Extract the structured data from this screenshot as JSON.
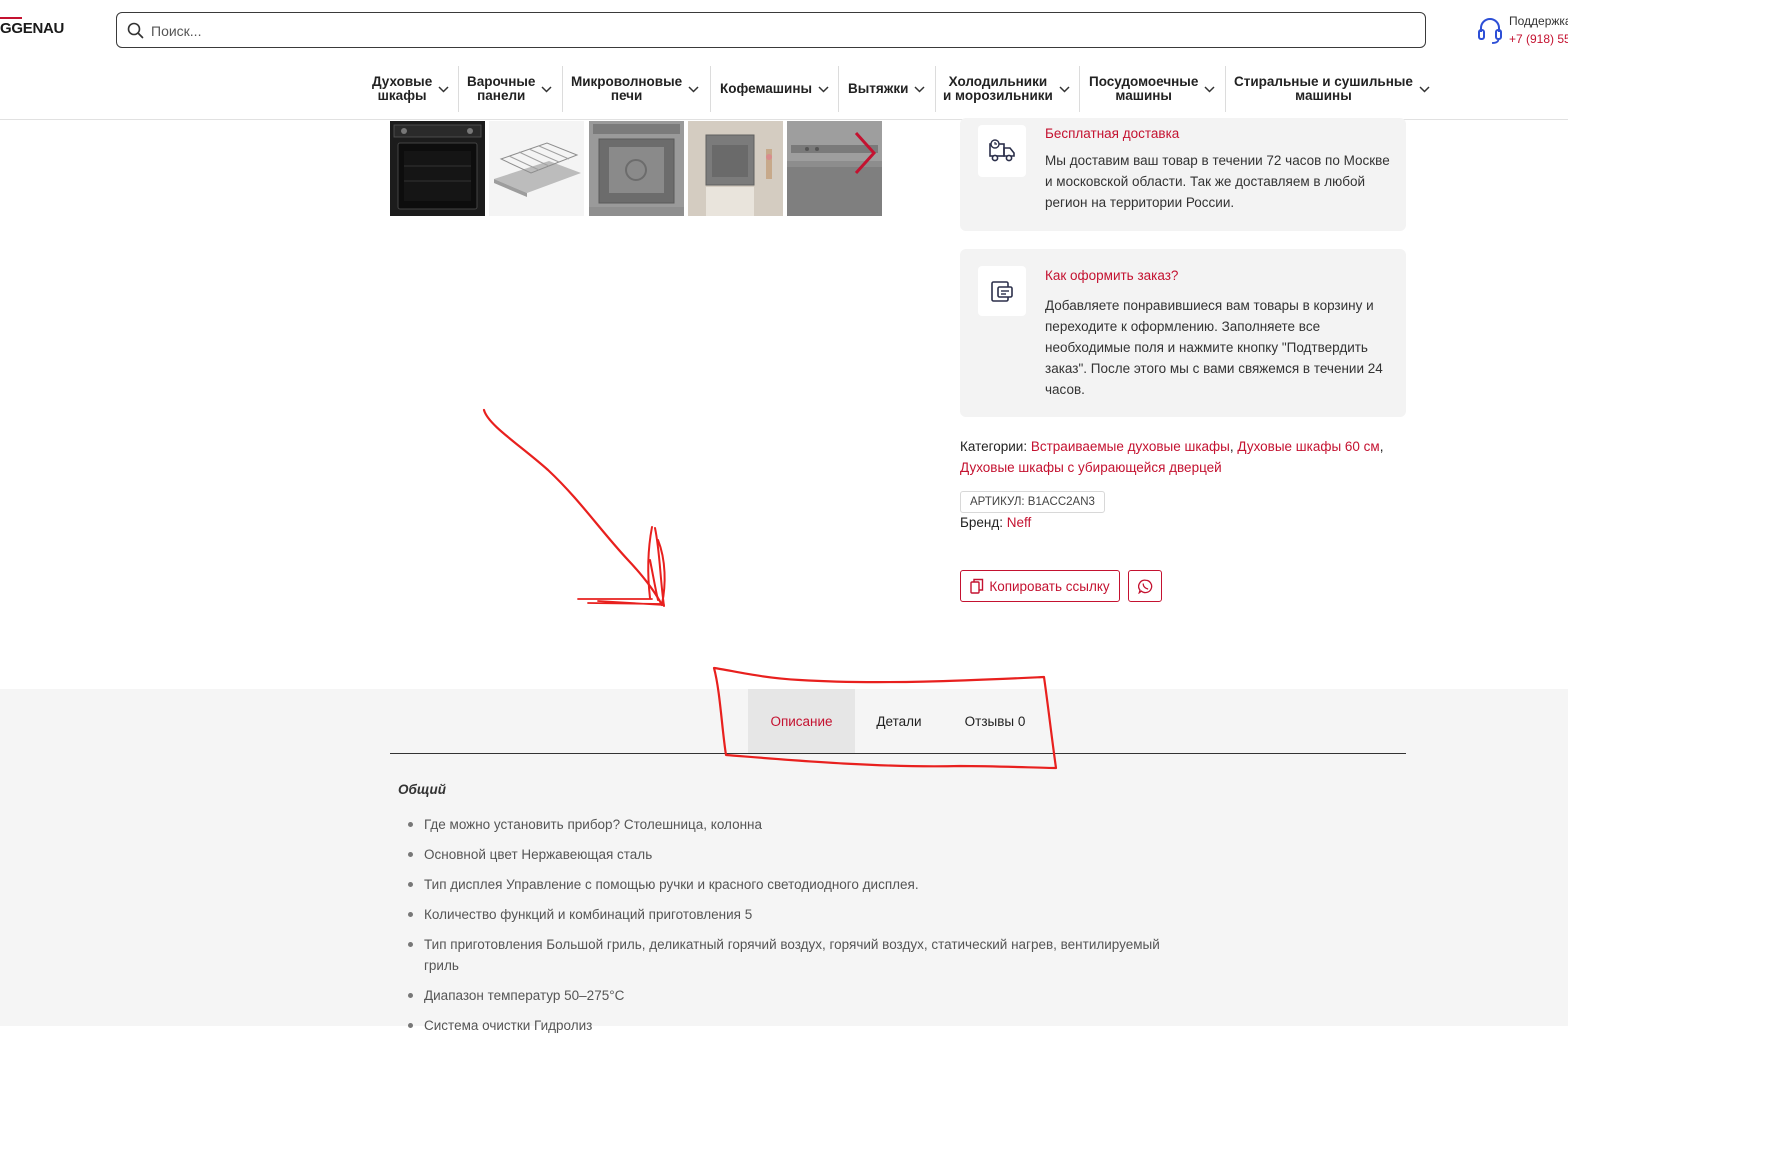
{
  "header": {
    "logo_text": "GGENAU",
    "search_placeholder": "Поиск...",
    "support_title": "Поддержка",
    "support_phone": "+7 (918) 55"
  },
  "nav": {
    "items": [
      {
        "label": "Духовые\nшкафы"
      },
      {
        "label": "Варочные\nпанели"
      },
      {
        "label": "Микроволновые\nпечи"
      },
      {
        "label": "Кофемашины"
      },
      {
        "label": "Вытяжки"
      },
      {
        "label": "Холодильники\nи морозильники"
      },
      {
        "label": "Посудомоечные\nмашины"
      },
      {
        "label": "Стиральные и сушильные\nмашины"
      }
    ]
  },
  "gallery": {
    "thumbnails": [
      "oven-front",
      "wire-rack",
      "oven-interior",
      "oven-in-kitchen",
      "oven-closeup"
    ],
    "next_icon": "chevron-right-icon"
  },
  "cards": {
    "delivery": {
      "icon": "truck-icon",
      "title": "Бесплатная доставка",
      "text": "Мы доставим ваш товар в течении 72 часов по Москве и московской области. Так же доставляем в любой регион на территории России."
    },
    "order": {
      "icon": "wallet-icon",
      "title": "Как оформить заказ?",
      "text": "Добавляете понравившиеся вам товары в корзину и переходите к оформлению. Заполняете все необходимые поля и нажмите кнопку \"Подтвердить заказ\". После этого мы с вами свяжемся в течении 24 часов."
    }
  },
  "product": {
    "categories_label": "Категории:",
    "categories": [
      "Встраиваемые духовые шкафы",
      "Духовые шкафы 60 см",
      "Духовые шкафы с убирающейся дверцей"
    ],
    "sku_label": "АРТИКУЛ: B1ACC2AN3",
    "brand_label": "Бренд:",
    "brand_name": "Neff",
    "copy_link_label": "Копировать ссылку",
    "share_icon": "whatsapp-icon"
  },
  "tabs": [
    {
      "label": "Описание",
      "active": true
    },
    {
      "label": "Детали",
      "active": false
    },
    {
      "label": "Отзывы 0",
      "active": false
    }
  ],
  "description": {
    "section_title": "Общий",
    "specs": [
      "Где можно установить прибор? Столешница, колонна",
      "Основной цвет Нержавеющая сталь",
      "Тип дисплея Управление с помощью ручки и красного светодиодного дисплея.",
      "Количество функций и комбинаций приготовления 5",
      "Тип приготовления Большой гриль, деликатный горячий воздух, горячий воздух, статический нагрев, вентилируемый гриль",
      "Диапазон температур 50–275°C",
      "Система очистки Гидролиз"
    ]
  },
  "colors": {
    "accent": "#c41230",
    "annotation": "#e8201e",
    "tab_active_bg": "#e6e6e6",
    "section_bg": "#f5f5f5",
    "card_bg": "#f3f3f3"
  }
}
